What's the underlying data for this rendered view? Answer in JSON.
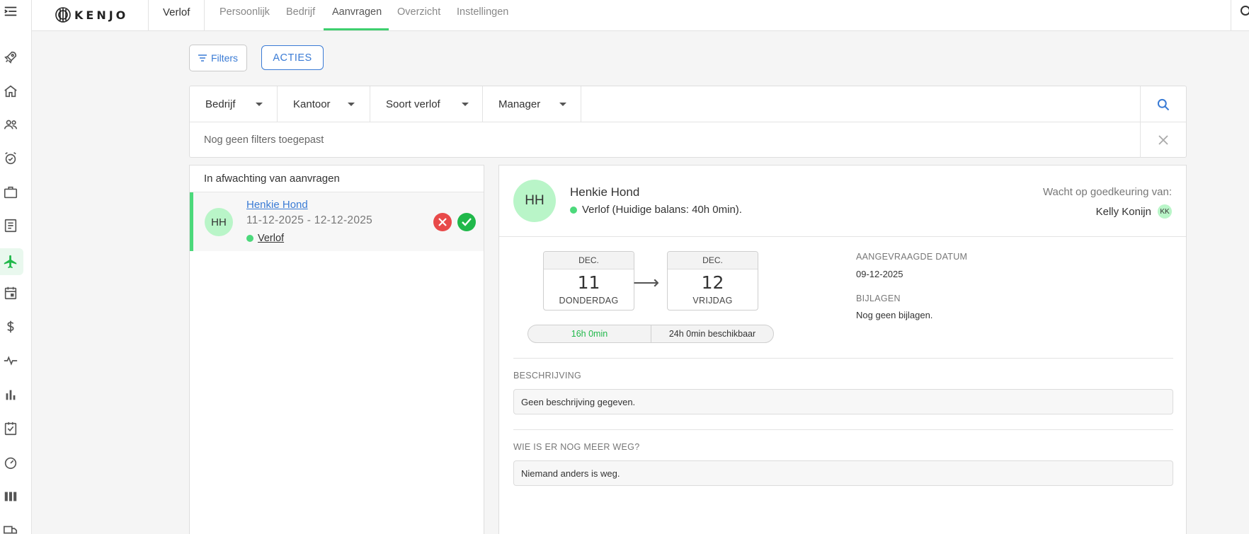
{
  "app": {
    "logo_text": "KENJO",
    "section": "Verlof"
  },
  "nav_tabs": [
    {
      "label": "Persoonlijk"
    },
    {
      "label": "Bedrijf"
    },
    {
      "label": "Aanvragen"
    },
    {
      "label": "Overzicht"
    },
    {
      "label": "Instellingen"
    }
  ],
  "active_tab": "Aanvragen",
  "toolbar": {
    "filters_label": "Filters",
    "acties_label": "ACTIES"
  },
  "filterbar": {
    "dropdowns": [
      {
        "label": "Bedrijf"
      },
      {
        "label": "Kantoor"
      },
      {
        "label": "Soort verlof"
      },
      {
        "label": "Manager"
      }
    ],
    "no_filters_text": "Nog geen filters toegepast"
  },
  "pending": {
    "title": "In afwachting van aanvragen",
    "items": [
      {
        "initials": "HH",
        "name": "Henkie Hond",
        "dates": "11-12-2025 - 12-12-2025",
        "type": "Verlof"
      }
    ]
  },
  "detail": {
    "initials": "HH",
    "name": "Henkie Hond",
    "type_line": "Verlof (Huidige balans: 40h 0min).",
    "waiting_label": "Wacht op goedkeuring van:",
    "approver_name": "Kelly Konijn",
    "approver_initials": "KK",
    "from": {
      "month": "DEC.",
      "day": "11",
      "weekday": "DONDERDAG"
    },
    "to": {
      "month": "DEC.",
      "day": "12",
      "weekday": "VRIJDAG"
    },
    "arrow": "⟶",
    "duration_used": "16h 0min",
    "duration_available": "24h 0min beschikbaar",
    "requested_date_label": "AANGEVRAAGDE DATUM",
    "requested_date": "09-12-2025",
    "attachments_label": "BIJLAGEN",
    "attachments_value": "Nog geen bijlagen.",
    "description_label": "BESCHRIJVING",
    "description_value": "Geen beschrijving gegeven.",
    "who_else_label": "WIE IS ER NOG MEER WEG?",
    "who_else_value": "Niemand anders is weg."
  },
  "colors": {
    "accent": "#3ecf6e",
    "link": "#3a7bd5",
    "reject": "#e84a4a",
    "approve": "#20b84a",
    "avatar_bg": "#b9f5c8"
  }
}
